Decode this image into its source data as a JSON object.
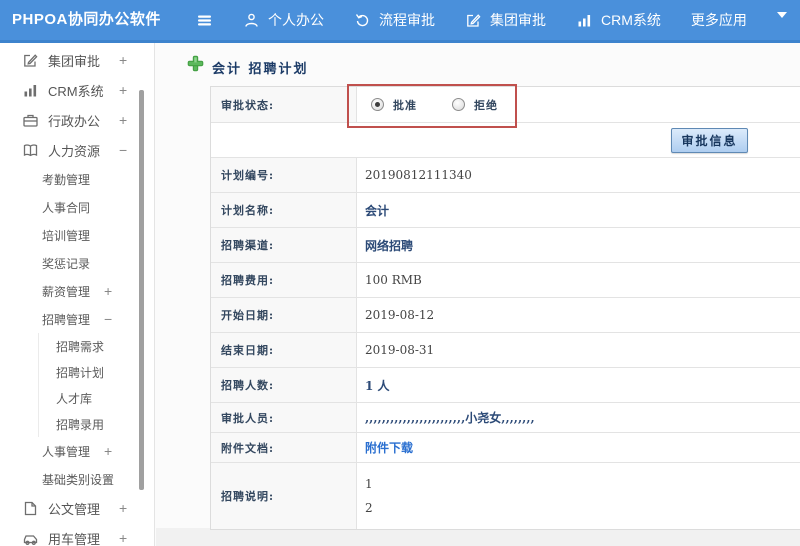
{
  "header": {
    "app_title": "PHPOA协同办公软件",
    "nav": [
      {
        "key": "menu",
        "icon": "menu-icon",
        "label": ""
      },
      {
        "key": "personal",
        "icon": "person-icon",
        "label": "个人办公"
      },
      {
        "key": "process",
        "icon": "process-icon",
        "label": "流程审批"
      },
      {
        "key": "group",
        "icon": "edit-icon",
        "label": "集团审批"
      },
      {
        "key": "crm",
        "icon": "chart-icon",
        "label": "CRM系统"
      },
      {
        "key": "more",
        "icon": "",
        "label": "更多应用"
      },
      {
        "key": "more-caret",
        "icon": "caret-down-icon",
        "label": ""
      }
    ]
  },
  "sidebar": {
    "items": [
      {
        "key": "group-approval",
        "label": "集团审批",
        "level": 1,
        "icon": "edit-icon",
        "toggle": "+"
      },
      {
        "key": "crm-system",
        "label": "CRM系统",
        "level": 1,
        "icon": "chart-icon",
        "toggle": "+"
      },
      {
        "key": "admin-office",
        "label": "行政办公",
        "level": 1,
        "icon": "briefcase-icon",
        "toggle": "+"
      },
      {
        "key": "hr",
        "label": "人力资源",
        "level": 1,
        "icon": "book-icon",
        "toggle": "−"
      },
      {
        "key": "attendance",
        "label": "考勤管理",
        "level": 2,
        "icon": "",
        "toggle": ""
      },
      {
        "key": "hr-contract",
        "label": "人事合同",
        "level": 2,
        "icon": "",
        "toggle": ""
      },
      {
        "key": "training",
        "label": "培训管理",
        "level": 2,
        "icon": "",
        "toggle": ""
      },
      {
        "key": "rewards",
        "label": "奖惩记录",
        "level": 2,
        "icon": "",
        "toggle": ""
      },
      {
        "key": "salary",
        "label": "薪资管理",
        "level": 2,
        "icon": "",
        "toggle": "+"
      },
      {
        "key": "recruit-mgmt",
        "label": "招聘管理",
        "level": 2,
        "icon": "",
        "toggle": "−"
      },
      {
        "key": "recruit-need",
        "label": "招聘需求",
        "level": 3,
        "icon": "",
        "toggle": ""
      },
      {
        "key": "recruit-plan",
        "label": "招聘计划",
        "level": 3,
        "icon": "",
        "toggle": ""
      },
      {
        "key": "talent-pool",
        "label": "人才库",
        "level": 3,
        "icon": "",
        "toggle": ""
      },
      {
        "key": "recruit-hire",
        "label": "招聘录用",
        "level": 3,
        "icon": "",
        "toggle": ""
      },
      {
        "key": "personnel-mgmt",
        "label": "人事管理",
        "level": 2,
        "icon": "",
        "toggle": "+"
      },
      {
        "key": "base-category",
        "label": "基础类别设置",
        "level": 2,
        "icon": "",
        "toggle": "+"
      },
      {
        "key": "doc-mgmt",
        "label": "公文管理",
        "level": 1,
        "icon": "doc-icon",
        "toggle": "+"
      },
      {
        "key": "vehicle-mgmt",
        "label": "用车管理",
        "level": 1,
        "icon": "car-icon",
        "toggle": "+"
      }
    ]
  },
  "main": {
    "page_title": "会计 招聘计划",
    "approval": {
      "label": "审批状态:",
      "options": [
        {
          "label": "批准",
          "selected": true
        },
        {
          "label": "拒绝",
          "selected": false
        }
      ],
      "button_label": "审批信息"
    },
    "fields": [
      {
        "key": "plan-number",
        "label": "计划编号:",
        "value": "20190812111340",
        "style": "plain"
      },
      {
        "key": "plan-name",
        "label": "计划名称:",
        "value": "会计",
        "style": "strong"
      },
      {
        "key": "channel",
        "label": "招聘渠道:",
        "value": "网络招聘",
        "style": "strong"
      },
      {
        "key": "fee",
        "label": "招聘费用:",
        "value": "100 RMB",
        "style": "plain"
      },
      {
        "key": "start-date",
        "label": "开始日期:",
        "value": "2019-08-12",
        "style": "plain"
      },
      {
        "key": "end-date",
        "label": "结束日期:",
        "value": "2019-08-31",
        "style": "plain"
      },
      {
        "key": "headcount",
        "label": "招聘人数:",
        "value": "1 人",
        "style": "strong"
      },
      {
        "key": "approvers",
        "label": "审批人员:",
        "value": ",,,,,,,,,,,,,,,,,,,,,,,,小尧女,,,,,,,,",
        "style": "strong"
      },
      {
        "key": "attachment",
        "label": "附件文档:",
        "value": "附件下载",
        "style": "link"
      }
    ],
    "notes": {
      "key": "description",
      "label": "招聘说明:",
      "lines": [
        "1",
        "2"
      ]
    }
  },
  "colors": {
    "topbar": "#4a90db",
    "accent_navy": "#2c4a77",
    "annotation_red": "#c0504d",
    "link_blue": "#2a6fd0",
    "plus_green": "#5cb85c"
  }
}
